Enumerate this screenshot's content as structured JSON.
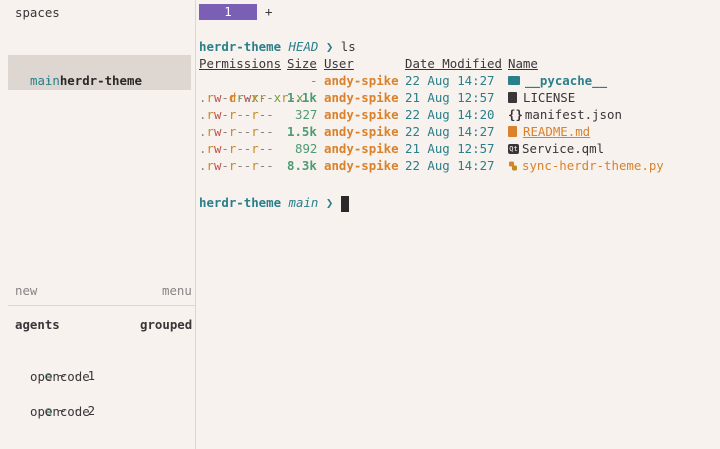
{
  "sidebar": {
    "spaces_title": "spaces",
    "workspaces": [
      {
        "name": "~"
      },
      {
        "name": "herdr-theme",
        "branch": "main",
        "bullet": "·"
      }
    ],
    "new_label": "new",
    "menu_label": "menu",
    "agents_title": "agents",
    "grouped_label": "grouped",
    "agents": [
      {
        "label": "~ · 1",
        "app": "opencode"
      },
      {
        "label": "~ · 2",
        "app": "opencode"
      }
    ]
  },
  "tabs": [
    {
      "label": "1"
    }
  ],
  "tab_add": "+",
  "terminal": {
    "prompt1": {
      "dir": "herdr-theme",
      "branch": "HEAD",
      "arrow": "❯",
      "cmd": "ls"
    },
    "headers": {
      "permissions": "Permissions",
      "size": "Size",
      "user": "User",
      "date": "Date Modified",
      "name": "Name"
    },
    "rows": [
      {
        "perm": "drwxr-xr-x",
        "size": "-",
        "user": "andy-spike",
        "date": "22 Aug 14:27",
        "name": "__pycache__",
        "icon": "folder-icon"
      },
      {
        "perm": ".rw-r--r--",
        "size": "1.1k",
        "user": "andy-spike",
        "date": "21 Aug 12:57",
        "name": "LICENSE",
        "icon": "file-icon"
      },
      {
        "perm": ".rw-r--r--",
        "size": "327",
        "user": "andy-spike",
        "date": "22 Aug 14:20",
        "name": "manifest.json",
        "icon": "json-icon"
      },
      {
        "perm": ".rw-r--r--",
        "size": "1.5k",
        "user": "andy-spike",
        "date": "22 Aug 14:27",
        "name": "README.md",
        "icon": "markdown-icon"
      },
      {
        "perm": ".rw-r--r--",
        "size": "892",
        "user": "andy-spike",
        "date": "21 Aug 12:57",
        "name": "Service.qml",
        "icon": "qt-icon"
      },
      {
        "perm": ".rw-r--r--",
        "size": "8.3k",
        "user": "andy-spike",
        "date": "22 Aug 14:27",
        "name": "sync-herdr-theme.py",
        "icon": "python-icon"
      }
    ],
    "prompt2": {
      "dir": "herdr-theme",
      "branch": "main",
      "arrow": "❯"
    }
  },
  "colors": {
    "background": "#f7f2ee",
    "accent_tab": "#7a5fb5",
    "teal": "#2a7f8a",
    "orange": "#d9822b",
    "green": "#4d9b73"
  }
}
